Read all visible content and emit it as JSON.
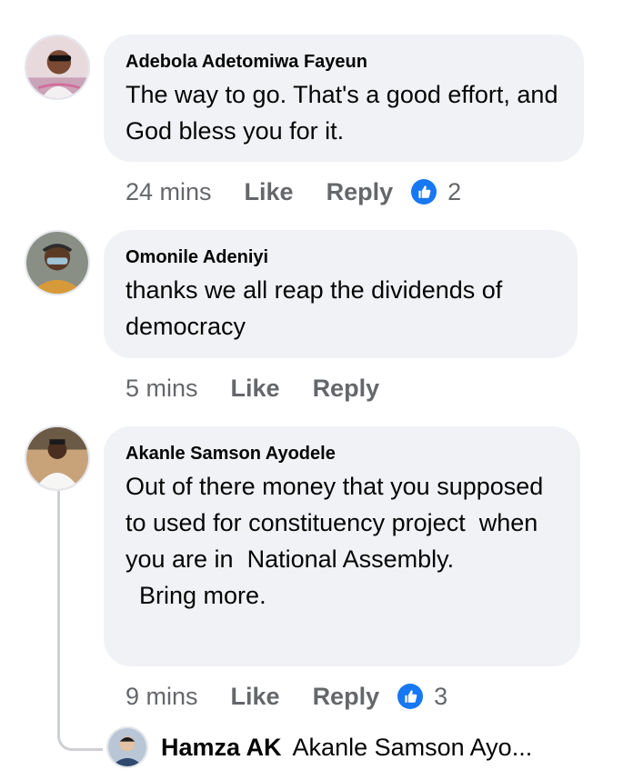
{
  "comments": [
    {
      "author": "Adebola Adetomiwa Fayeun",
      "text": "The way to go. That's a good effort, and God bless you for it.",
      "time": "24 mins",
      "like_label": "Like",
      "reply_label": "Reply",
      "reaction_count": "2"
    },
    {
      "author": "Omonile Adeniyi",
      "text": "thanks we all reap the dividends of democracy",
      "time": "5 mins",
      "like_label": "Like",
      "reply_label": "Reply"
    },
    {
      "author": "Akanle Samson Ayodele",
      "text": "Out of there money that you supposed to used for constituency project  when you are in  National Assembly.\n  Bring more.",
      "time": "9 mins",
      "like_label": "Like",
      "reply_label": "Reply",
      "reaction_count": "3"
    }
  ],
  "reply_preview": {
    "author": "Hamza AK",
    "text": "Akanle Samson Ayo..."
  },
  "colors": {
    "bubble": "#f0f2f5",
    "muted": "#65676b",
    "like_blue": "#1877f2"
  },
  "icons": {
    "reaction": "thumbs-up-icon"
  }
}
